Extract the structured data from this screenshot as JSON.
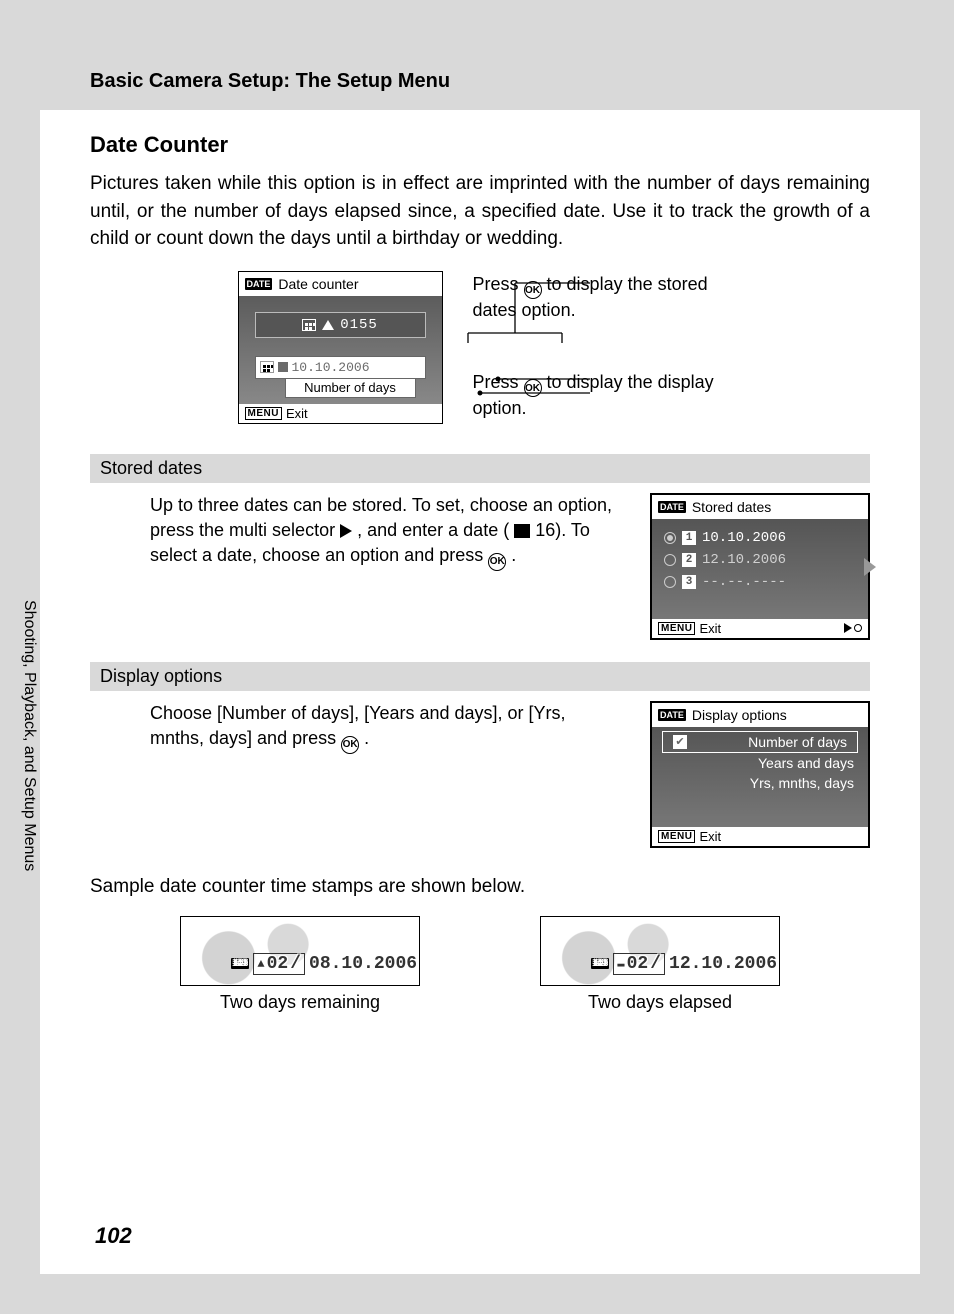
{
  "header": {
    "title": "Basic Camera Setup: The Setup Menu"
  },
  "section_title": "Date Counter",
  "intro": "Pictures taken while this option is in effect are imprinted with the number of days remaining until, or the number of days elapsed since, a specified date. Use it to track the growth of a child or count down the days until a birthday or wedding.",
  "lcd_main": {
    "title": "Date counter",
    "counter_value": "0155",
    "date_value": "10.10.2006",
    "sublabel": "Number of days",
    "exit": "Exit",
    "menu_label": "MENU"
  },
  "callouts": {
    "top_pre": "Press ",
    "top_post": " to display the stored dates option.",
    "bottom_pre": "Press ",
    "bottom_post": " to display the display option.",
    "ok": "OK"
  },
  "stored": {
    "header": "Stored dates",
    "text_a": "Up to three dates can be stored. To set, choose an option, press the multi selector ",
    "text_b": " , and enter a date (",
    "text_c": " 16). To select a date, choose an option and press ",
    "text_d": ".",
    "lcd_title": "Stored dates",
    "rows": [
      {
        "n": "1",
        "date": "10.10.2006"
      },
      {
        "n": "2",
        "date": "12.10.2006"
      },
      {
        "n": "3",
        "date": "--.--.----"
      }
    ],
    "exit": "Exit"
  },
  "display": {
    "header": "Display options",
    "text_a": "Choose [Number of days], [Years and days], or [Yrs, mnths, days] and press ",
    "text_b": ".",
    "lcd_title": "Display options",
    "options": [
      "Number of days",
      "Years and days",
      "Yrs, mnths, days"
    ],
    "exit": "Exit"
  },
  "samples": {
    "intro": "Sample date counter time stamps are shown below.",
    "left": {
      "count": "02",
      "date": "08.10.2006",
      "caption": "Two days remaining",
      "sym": "▲"
    },
    "right": {
      "count": "02",
      "date": "12.10.2006",
      "caption": "Two days elapsed",
      "sym": "▬"
    }
  },
  "side_label": "Shooting, Playback, and Setup Menus",
  "page_number": "102"
}
